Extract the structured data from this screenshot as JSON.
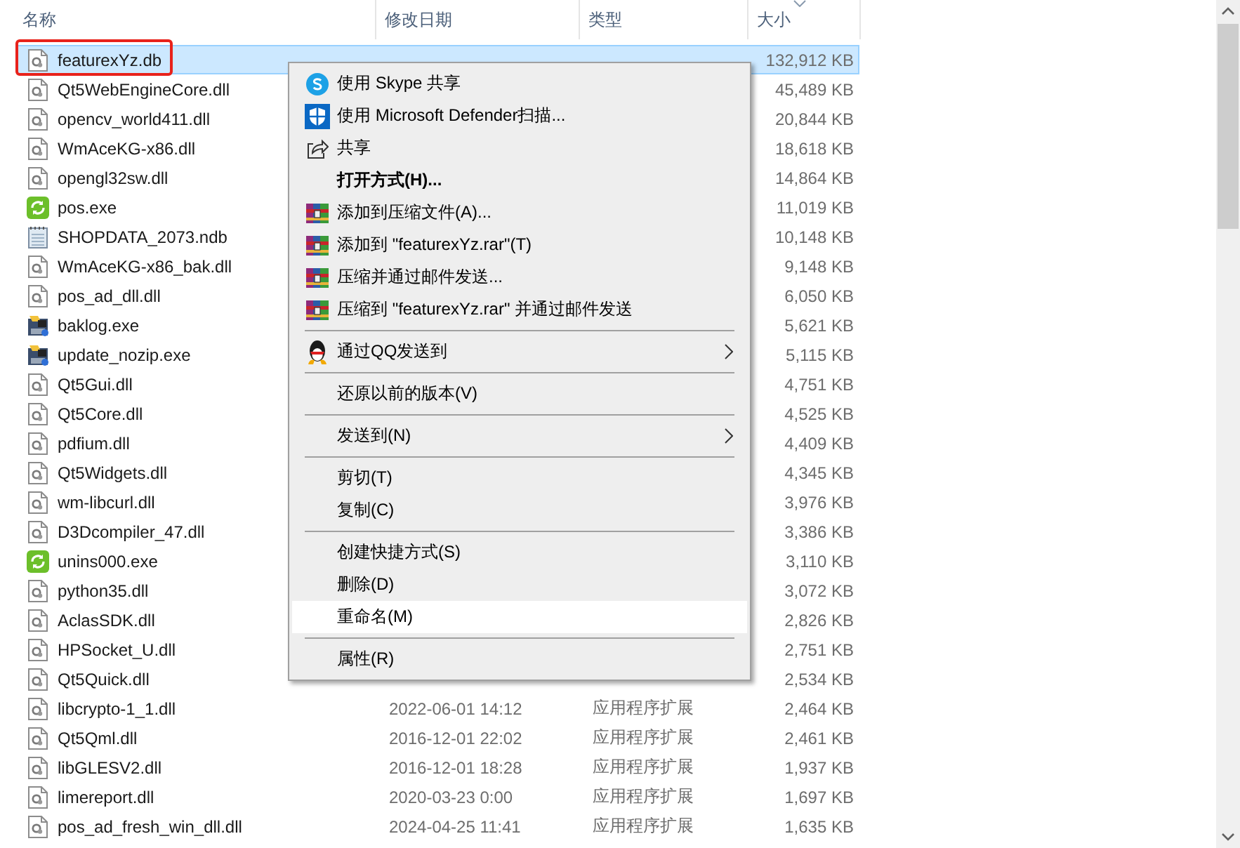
{
  "columns": [
    {
      "label": "名称",
      "sorted": false
    },
    {
      "label": "修改日期",
      "sorted": false
    },
    {
      "label": "类型",
      "sorted": false
    },
    {
      "label": "大小",
      "sorted": true
    }
  ],
  "files": [
    {
      "name": "featurexYz.db",
      "kind": "dll",
      "size": "132,912 KB",
      "selected": true,
      "outlined": true
    },
    {
      "name": "Qt5WebEngineCore.dll",
      "kind": "dll",
      "size": "45,489 KB",
      "selected": false,
      "outlined": false
    },
    {
      "name": "opencv_world411.dll",
      "kind": "dll",
      "size": "20,844 KB",
      "selected": false,
      "outlined": false
    },
    {
      "name": "WmAceKG-x86.dll",
      "kind": "dll",
      "size": "18,618 KB",
      "selected": false,
      "outlined": false
    },
    {
      "name": "opengl32sw.dll",
      "kind": "dll",
      "size": "14,864 KB",
      "selected": false,
      "outlined": false
    },
    {
      "name": "pos.exe",
      "kind": "app",
      "size": "11,019 KB",
      "selected": false,
      "outlined": false
    },
    {
      "name": "SHOPDATA_2073.ndb",
      "kind": "notes",
      "size": "10,148 KB",
      "selected": false,
      "outlined": false
    },
    {
      "name": "WmAceKG-x86_bak.dll",
      "kind": "dll",
      "size": "9,148 KB",
      "selected": false,
      "outlined": false
    },
    {
      "name": "pos_ad_dll.dll",
      "kind": "dll",
      "size": "6,050 KB",
      "selected": false,
      "outlined": false
    },
    {
      "name": "baklog.exe",
      "kind": "installer",
      "size": "5,621 KB",
      "selected": false,
      "outlined": false
    },
    {
      "name": "update_nozip.exe",
      "kind": "installer",
      "size": "5,115 KB",
      "selected": false,
      "outlined": false
    },
    {
      "name": "Qt5Gui.dll",
      "kind": "dll",
      "size": "4,751 KB",
      "selected": false,
      "outlined": false
    },
    {
      "name": "Qt5Core.dll",
      "kind": "dll",
      "size": "4,525 KB",
      "selected": false,
      "outlined": false
    },
    {
      "name": "pdfium.dll",
      "kind": "dll",
      "size": "4,409 KB",
      "selected": false,
      "outlined": false
    },
    {
      "name": "Qt5Widgets.dll",
      "kind": "dll",
      "size": "4,345 KB",
      "selected": false,
      "outlined": false
    },
    {
      "name": "wm-libcurl.dll",
      "kind": "dll",
      "size": "3,976 KB",
      "selected": false,
      "outlined": false
    },
    {
      "name": "D3Dcompiler_47.dll",
      "kind": "dll",
      "size": "3,386 KB",
      "selected": false,
      "outlined": false
    },
    {
      "name": "unins000.exe",
      "kind": "app",
      "size": "3,110 KB",
      "selected": false,
      "outlined": false
    },
    {
      "name": "python35.dll",
      "kind": "dll",
      "size": "3,072 KB",
      "selected": false,
      "outlined": false
    },
    {
      "name": "AclasSDK.dll",
      "kind": "dll",
      "size": "2,826 KB",
      "selected": false,
      "outlined": false
    },
    {
      "name": "HPSocket_U.dll",
      "kind": "dll",
      "size": "2,751 KB",
      "selected": false,
      "outlined": false
    },
    {
      "name": "Qt5Quick.dll",
      "kind": "dll",
      "size": "2,534 KB",
      "selected": false,
      "outlined": false
    },
    {
      "name": "libcrypto-1_1.dll",
      "kind": "dll",
      "date": "2022-06-01 14:12",
      "type": "应用程序扩展",
      "size": "2,464 KB",
      "selected": false,
      "outlined": false
    },
    {
      "name": "Qt5Qml.dll",
      "kind": "dll",
      "date": "2016-12-01 22:02",
      "type": "应用程序扩展",
      "size": "2,461 KB",
      "selected": false,
      "outlined": false
    },
    {
      "name": "libGLESV2.dll",
      "kind": "dll",
      "date": "2016-12-01 18:28",
      "type": "应用程序扩展",
      "size": "1,937 KB",
      "selected": false,
      "outlined": false
    },
    {
      "name": "limereport.dll",
      "kind": "dll",
      "date": "2020-03-23 0:00",
      "type": "应用程序扩展",
      "size": "1,697 KB",
      "selected": false,
      "outlined": false
    },
    {
      "name": "pos_ad_fresh_win_dll.dll",
      "kind": "dll",
      "date": "2024-04-25 11:41",
      "type": "应用程序扩展",
      "size": "1,635 KB",
      "selected": false,
      "outlined": false
    }
  ],
  "context_menu": [
    {
      "kind": "skype",
      "label": "使用 Skype 共享",
      "selected": false
    },
    {
      "kind": "defender",
      "label": "使用 Microsoft Defender扫描...",
      "selected": false
    },
    {
      "kind": "share",
      "label": "共享",
      "selected": false
    },
    {
      "kind": "plain",
      "label": "打开方式(H)...",
      "bold": true,
      "selected": false
    },
    {
      "kind": "archive",
      "label": "添加到压缩文件(A)...",
      "selected": false
    },
    {
      "kind": "archive",
      "label": "添加到 \"featurexYz.rar\"(T)",
      "selected": false
    },
    {
      "kind": "archive",
      "label": "压缩并通过邮件发送...",
      "selected": false
    },
    {
      "kind": "archive",
      "label": "压缩到 \"featurexYz.rar\" 并通过邮件发送",
      "selected": false
    },
    {
      "kind": "separator"
    },
    {
      "kind": "qq",
      "label": "通过QQ发送到",
      "submenu": true,
      "selected": false
    },
    {
      "kind": "separator"
    },
    {
      "kind": "plain",
      "label": "还原以前的版本(V)",
      "selected": false
    },
    {
      "kind": "separator"
    },
    {
      "kind": "plain",
      "label": "发送到(N)",
      "submenu": true,
      "selected": false
    },
    {
      "kind": "separator"
    },
    {
      "kind": "plain",
      "label": "剪切(T)",
      "selected": false
    },
    {
      "kind": "plain",
      "label": "复制(C)",
      "selected": false
    },
    {
      "kind": "separator"
    },
    {
      "kind": "plain",
      "label": "创建快捷方式(S)",
      "selected": false
    },
    {
      "kind": "plain",
      "label": "删除(D)",
      "selected": false
    },
    {
      "kind": "plain",
      "label": "重命名(M)",
      "selected": true
    },
    {
      "kind": "separator"
    },
    {
      "kind": "plain",
      "label": "属性(R)",
      "selected": false
    }
  ]
}
